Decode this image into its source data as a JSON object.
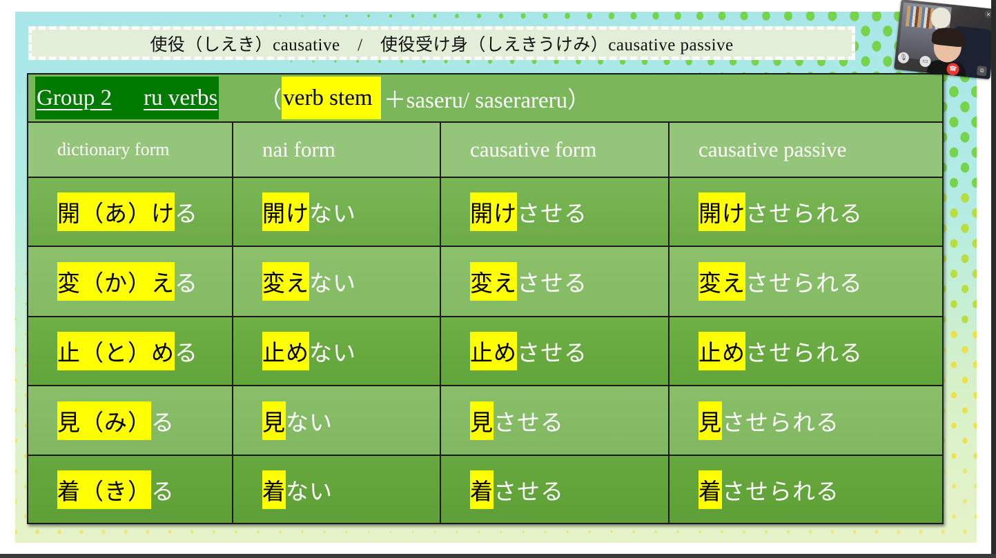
{
  "slide": {
    "title": "使役（しえき）causative　/　使役受け身（しえきうけみ）causative passive",
    "group_label_part1": "Group 2",
    "group_label_part2": "ru verbs",
    "formula_open": "（",
    "formula_stem": "verb stem",
    "formula_rest": "＋saseru/ saserareru）",
    "columns": [
      "dictionary form",
      "nai form",
      "causative form",
      "causative passive"
    ],
    "rows": [
      {
        "dictionary": {
          "stem": "開（あ）け",
          "rest": "る"
        },
        "nai": {
          "stem": "開け",
          "rest": "ない"
        },
        "causative": {
          "stem": "開け",
          "rest": "させる"
        },
        "causative_passive": {
          "stem": "開け",
          "rest": "させられる"
        }
      },
      {
        "dictionary": {
          "stem": "変（か）え",
          "rest": "る"
        },
        "nai": {
          "stem": "変え",
          "rest": "ない"
        },
        "causative": {
          "stem": "変え",
          "rest": "させる"
        },
        "causative_passive": {
          "stem": "変え",
          "rest": "させられる"
        }
      },
      {
        "dictionary": {
          "stem": "止（と）め",
          "rest": "る"
        },
        "nai": {
          "stem": "止め",
          "rest": "ない"
        },
        "causative": {
          "stem": "止め",
          "rest": "させる"
        },
        "causative_passive": {
          "stem": "止め",
          "rest": "させられる"
        }
      },
      {
        "dictionary": {
          "stem": "見（み）",
          "rest": "る"
        },
        "nai": {
          "stem": "見",
          "rest": "ない"
        },
        "causative": {
          "stem": "見",
          "rest": "させる"
        },
        "causative_passive": {
          "stem": "見",
          "rest": "させられる"
        }
      },
      {
        "dictionary": {
          "stem": "着（き）",
          "rest": "る"
        },
        "nai": {
          "stem": "着",
          "rest": "ない"
        },
        "causative": {
          "stem": "着",
          "rest": "させる"
        },
        "causative_passive": {
          "stem": "着",
          "rest": "させられる"
        }
      }
    ]
  },
  "video_call": {
    "icons": {
      "mic": "microphone-icon",
      "camera": "video-camera-icon",
      "end_call": "end-call-icon",
      "close": "close-icon",
      "popout": "popout-icon"
    },
    "glyphs": {
      "mic": "🎙",
      "camera": "▭",
      "end_call": "☎",
      "close": "×",
      "popout": "⧉"
    }
  },
  "colors": {
    "highlight": "#ffff00",
    "group_label_bg": "#007a00",
    "header_bg": "#95c57a",
    "row_dark": "#6cab47",
    "row_light": "#85bb64",
    "end_call": "#e53935"
  }
}
